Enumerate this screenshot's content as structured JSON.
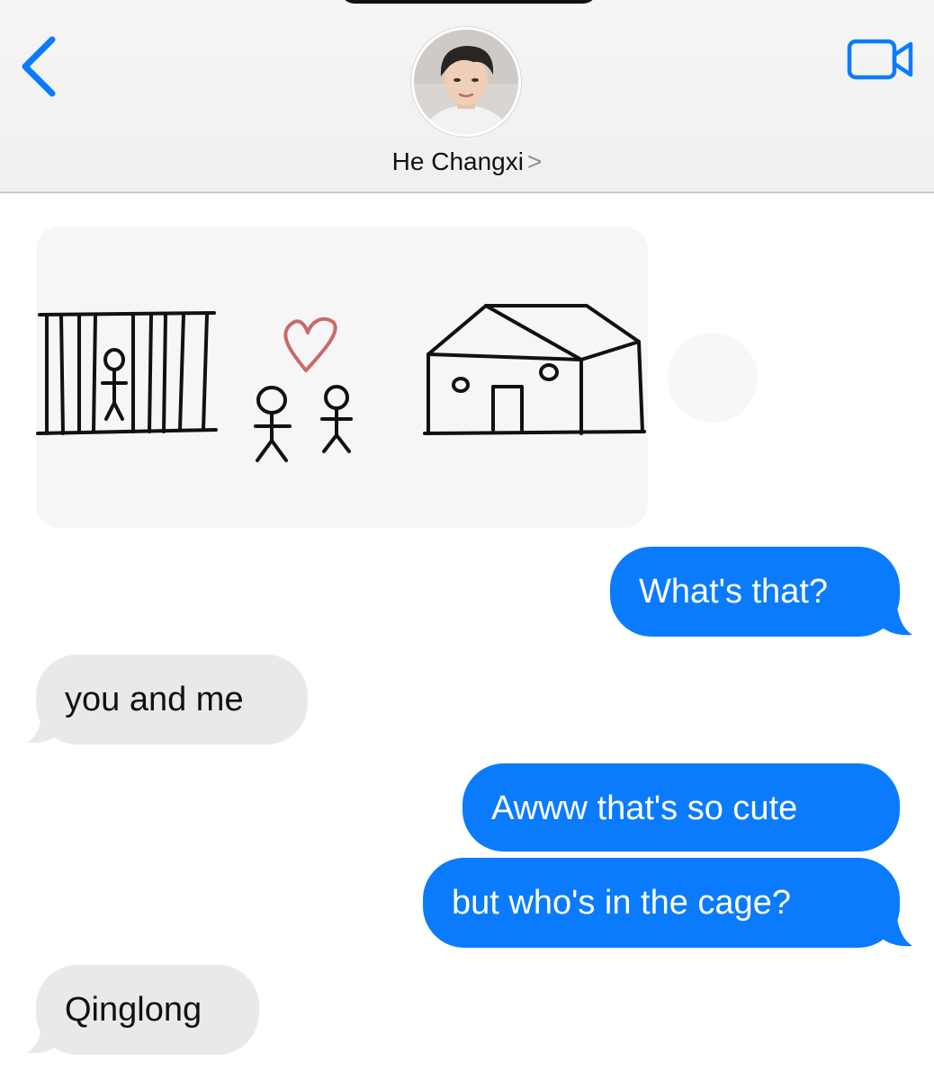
{
  "header": {
    "back_icon": "chevron-left-icon",
    "contact_name": "He Changxi",
    "contact_chevron": ">",
    "video_icon": "video-camera-icon",
    "accent_color": "#0b7bfd"
  },
  "conversation": {
    "image_attachment": {
      "description_icon": "drawing-cage-couple-house"
    },
    "messages": [
      {
        "sender": "me",
        "text": "What's that?"
      },
      {
        "sender": "them",
        "text": "you and me"
      },
      {
        "sender": "me",
        "text": "Awww that's so cute"
      },
      {
        "sender": "me",
        "text": "but who's in the cage?"
      },
      {
        "sender": "them",
        "text": "Qinglong"
      }
    ]
  },
  "colors": {
    "sent_bubble": "#0b7bfd",
    "received_bubble": "#e9e9eb",
    "heart": "#c96a6a"
  }
}
